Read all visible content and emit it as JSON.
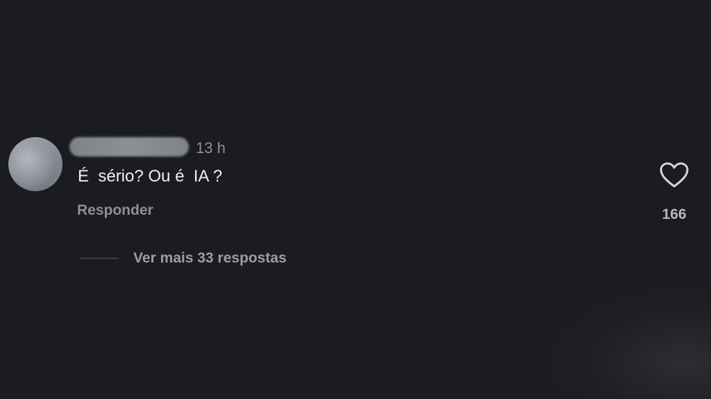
{
  "comment": {
    "timestamp": "13 h",
    "text": "É  sério? Ou é  IA ?",
    "reply_label": "Responder",
    "like_icon": "heart-outline-icon",
    "like_count": "166",
    "view_replies_label": "Ver mais 33 respostas"
  }
}
